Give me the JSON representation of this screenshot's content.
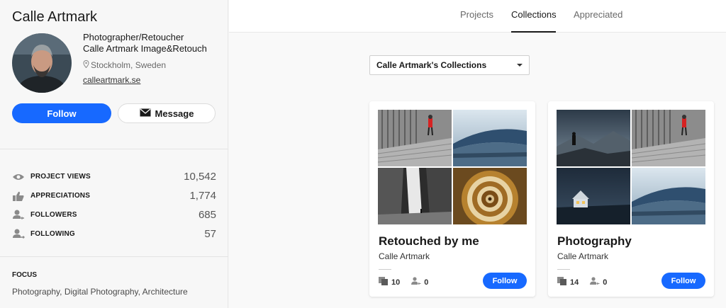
{
  "profile": {
    "name": "Calle Artmark",
    "occupation": "Photographer/Retoucher",
    "company": "Calle Artmark Image&Retouch",
    "location": "Stockholm, Sweden",
    "website": "calleartmark.se",
    "follow_label": "Follow",
    "message_label": "Message"
  },
  "stats": [
    {
      "label": "PROJECT VIEWS",
      "value": "10,542",
      "icon": "eye-icon"
    },
    {
      "label": "APPRECIATIONS",
      "value": "1,774",
      "icon": "thumbs-up-icon"
    },
    {
      "label": "FOLLOWERS",
      "value": "685",
      "icon": "followers-icon"
    },
    {
      "label": "FOLLOWING",
      "value": "57",
      "icon": "following-icon"
    }
  ],
  "focus": {
    "title": "FOCUS",
    "text": "Photography, Digital Photography, Architecture"
  },
  "tabs": [
    {
      "label": "Projects",
      "active": false
    },
    {
      "label": "Collections",
      "active": true
    },
    {
      "label": "Appreciated",
      "active": false
    }
  ],
  "collections_select": {
    "value": "Calle Artmark's Collections"
  },
  "collections": [
    {
      "title": "Retouched by me",
      "owner": "Calle Artmark",
      "projects": "10",
      "followers": "0",
      "follow_label": "Follow"
    },
    {
      "title": "Photography",
      "owner": "Calle Artmark",
      "projects": "14",
      "followers": "0",
      "follow_label": "Follow"
    }
  ],
  "colors": {
    "accent": "#1769ff",
    "sidebar_bg": "#f7f7f7"
  }
}
